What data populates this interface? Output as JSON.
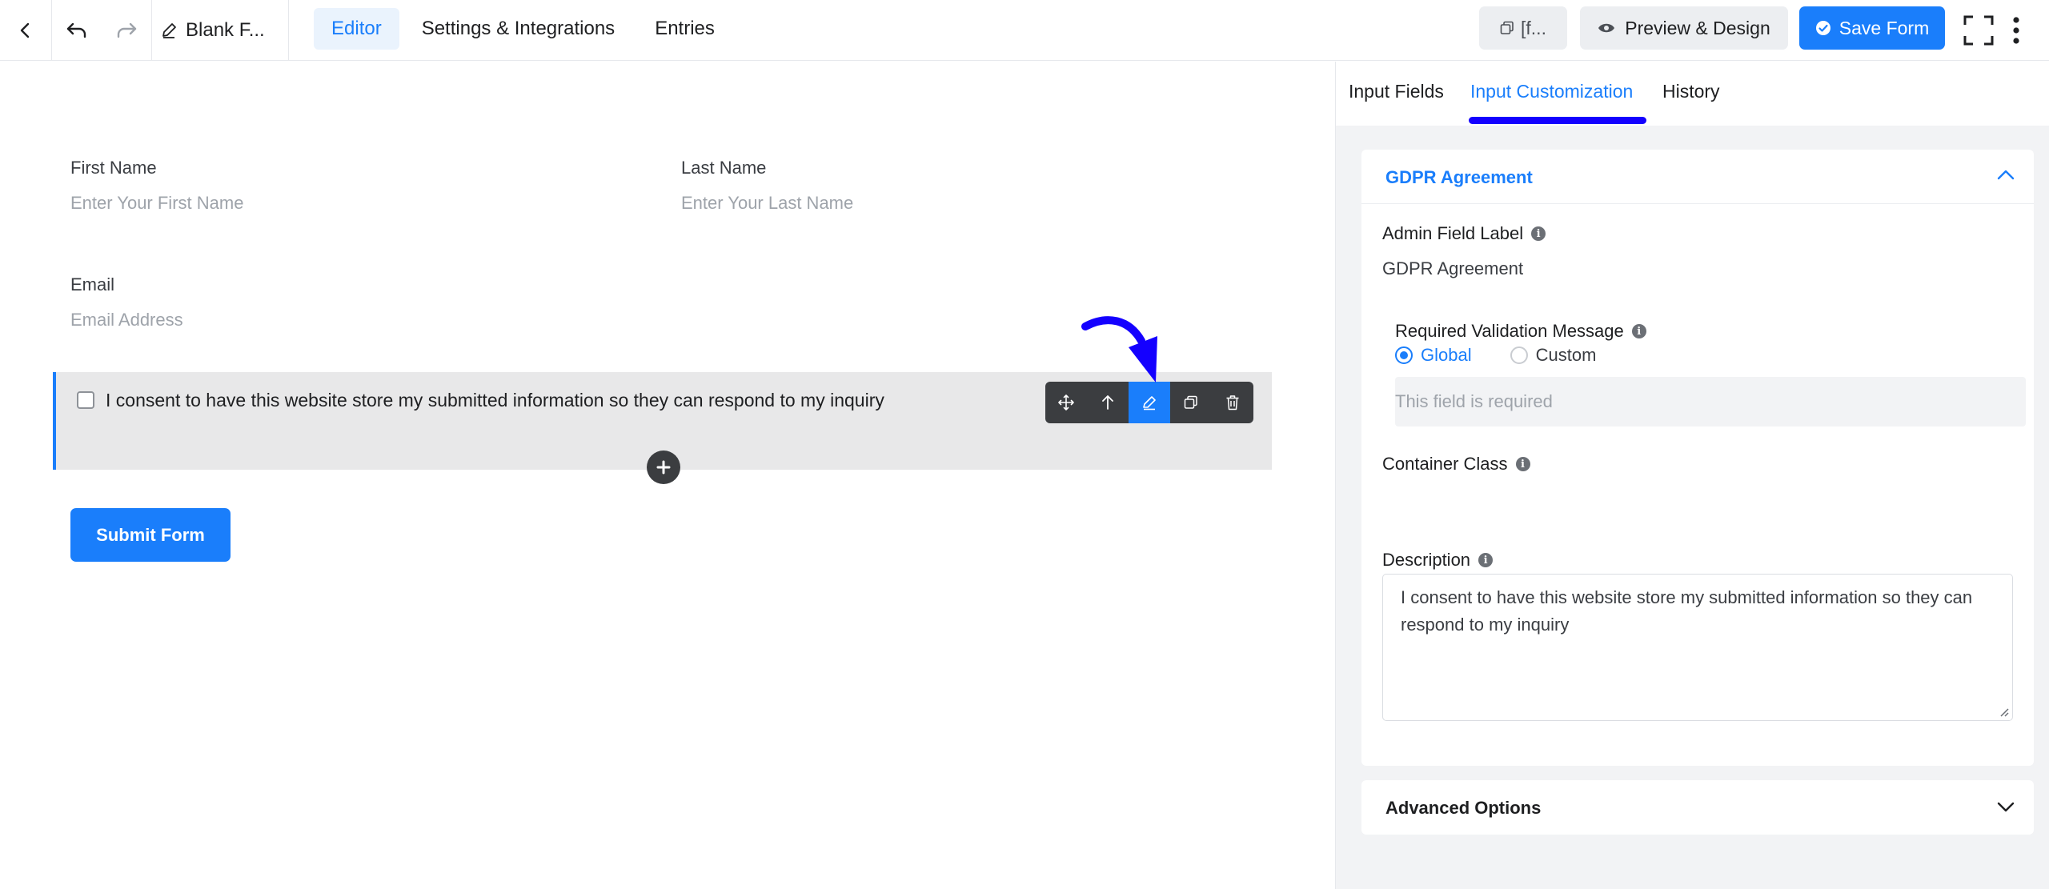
{
  "header": {
    "form_name": "Blank F...",
    "nav": [
      {
        "label": "Editor",
        "active": true
      },
      {
        "label": "Settings & Integrations",
        "active": false
      },
      {
        "label": "Entries",
        "active": false
      }
    ],
    "shortcode_label": "[f...",
    "preview_label": "Preview & Design",
    "save_label": "Save Form"
  },
  "form": {
    "first_name_label": "First Name",
    "first_name_placeholder": "Enter Your First Name",
    "last_name_label": "Last Name",
    "last_name_placeholder": "Enter Your Last Name",
    "email_label": "Email",
    "email_placeholder": "Email Address",
    "gdpr_text": "I consent to have this website store my submitted information so they can respond to my inquiry",
    "submit_label": "Submit Form"
  },
  "panel": {
    "tabs": [
      {
        "label": "Input Fields",
        "active": false
      },
      {
        "label": "Input Customization",
        "active": true
      },
      {
        "label": "History",
        "active": false
      }
    ],
    "section_title": "GDPR Agreement",
    "admin_label_title": "Admin Field Label",
    "admin_label_value": "GDPR Agreement",
    "validation_title": "Required Validation Message",
    "radio_global": "Global",
    "radio_custom": "Custom",
    "validation_placeholder": "This field is required",
    "container_class_title": "Container Class",
    "description_title": "Description",
    "description_value": "I consent to have this website store my submitted information so they can respond to my inquiry",
    "advanced_title": "Advanced Options"
  },
  "colors": {
    "accent": "#1a7efb",
    "annotation": "#1400ff"
  }
}
